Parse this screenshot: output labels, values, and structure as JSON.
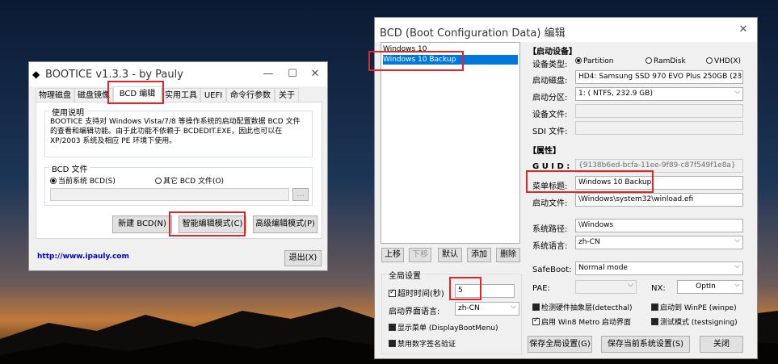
{
  "bootice": {
    "title": "BOOTICE v1.3.3 - by Pauly",
    "tabs": [
      "物理磁盘",
      "磁盘镜像",
      "BCD 编辑",
      "实用工具",
      "UEFI",
      "命令行参数",
      "关于"
    ],
    "usage_group": "使用说明",
    "usage_text": "BOOTICE 支持对 Windows Vista/7/8 等操作系统的启动配置数据 BCD 文件的查看和编辑功能。由于此功能不依赖于 BCDEDIT.EXE，因此也可以在 XP/2003 系统及相应 PE 环境下使用。",
    "bcd_group": "BCD 文件",
    "radio_current": "当前系统 BCD(S)",
    "radio_other": "其它 BCD 文件(O)",
    "browse_label": "...",
    "btn_new": "新建 BCD(N)",
    "btn_smart": "智能编辑模式(C)",
    "btn_advanced": "高级编辑模式(P)",
    "link": "http://www.ipauly.com",
    "btn_exit": "退出(X)"
  },
  "bcd": {
    "title": "BCD (Boot Configuration Data) 编辑",
    "entries": [
      "Windows 10",
      "Windows 10 Backup"
    ],
    "list_buttons": [
      "上移",
      "下移",
      "默认",
      "添加",
      "删除"
    ],
    "global_title": "全局设置",
    "timeout_label": "超时时间(秒)",
    "timeout_value": "5",
    "boot_lang_label": "启动界面语言:",
    "boot_lang_value": "zh-CN",
    "display_menu": "显示菜单 (DisplayBootMenu)",
    "disable_sig": "禁用数字签名验证",
    "boot_device_head": "【启动设备】",
    "device_type_label": "设备类型:",
    "dev_partition": "Partition",
    "dev_ramdisk": "RamDisk",
    "dev_vhd": "VHD(X)",
    "boot_disk_label": "启动磁盘:",
    "boot_disk_value": "HD4: Samsung SSD 970 EVO Plus 250GB (232.9",
    "boot_part_label": "启动分区:",
    "boot_part_value": "1: ( NTFS, 232.9 GB)",
    "device_file_label": "设备文件:",
    "sdi_label": "SDI 文件:",
    "attr_head": "【属性】",
    "guid_label": "G U I D :",
    "guid_value": "{9138b6ed-bcfa-11ee-9f89-c87f549f1e8a}",
    "menu_title_label": "菜单标题:",
    "menu_title_value": "Windows 10 Backup",
    "boot_file_label": "启动文件:",
    "boot_file_value": "\\Windows\\system32\\winload.efi",
    "sys_path_label": "系统路径:",
    "sys_path_value": "\\Windows",
    "sys_lang_label": "系统语言:",
    "sys_lang_value": "zh-CN",
    "safeboot_label": "SafeBoot:",
    "safeboot_value": "Normal mode",
    "pae_label": "PAE:",
    "nx_label": "NX:",
    "nx_value": "OptIn",
    "detect_hal": "检测硬件抽象层(detecthal)",
    "winpe": "启动到 WinPE (winpe)",
    "metro": "启用 Win8 Metro 启动界面",
    "testsign": "测试模式 (testsigning)",
    "btn_save_global": "保存全局设置(G)",
    "btn_save_current": "保存当前系统设置(S)",
    "btn_close": "关闭"
  }
}
